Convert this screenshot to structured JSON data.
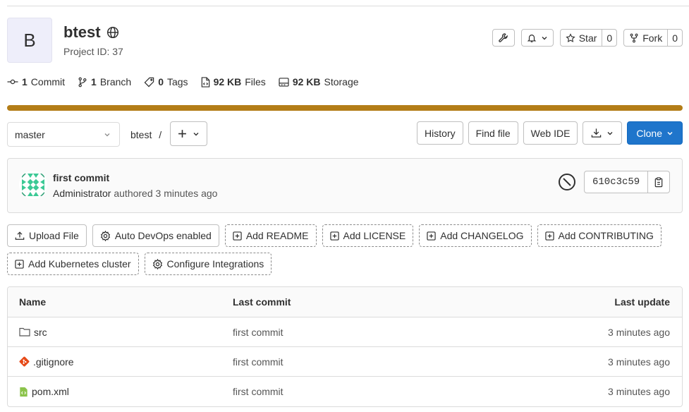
{
  "project": {
    "initial": "B",
    "name": "btest",
    "id_label": "Project ID: 37"
  },
  "actions": {
    "star_label": "Star",
    "star_count": "0",
    "fork_label": "Fork",
    "fork_count": "0"
  },
  "stats": {
    "commits_count": "1",
    "commits_label": "Commit",
    "branches_count": "1",
    "branches_label": "Branch",
    "tags_count": "0",
    "tags_label": "Tags",
    "files_size": "92 KB",
    "files_label": "Files",
    "storage_size": "92 KB",
    "storage_label": "Storage"
  },
  "storage_bar": {
    "fill_fraction": 1.0,
    "color": "#b37d17"
  },
  "toolbar": {
    "branch": "master",
    "breadcrumb_project": "btest",
    "breadcrumb_sep": "/",
    "history": "History",
    "find_file": "Find file",
    "web_ide": "Web IDE",
    "clone": "Clone"
  },
  "last_commit": {
    "title": "first commit",
    "author": "Administrator",
    "meta": "authored 3 minutes ago",
    "sha": "610c3c59"
  },
  "quick_actions": {
    "row1": [
      "Upload File",
      "Auto DevOps enabled",
      "Add README",
      "Add LICENSE",
      "Add CHANGELOG",
      "Add CONTRIBUTING"
    ],
    "row2": [
      "Add Kubernetes cluster",
      "Configure Integrations"
    ]
  },
  "file_table": {
    "headers": {
      "name": "Name",
      "last_commit": "Last commit",
      "last_update": "Last update"
    },
    "rows": [
      {
        "name": "src",
        "icon": "folder-icon",
        "commit": "first commit",
        "updated": "3 minutes ago"
      },
      {
        "name": ".gitignore",
        "icon": "git-file-icon",
        "commit": "first commit",
        "updated": "3 minutes ago"
      },
      {
        "name": "pom.xml",
        "icon": "xml-file-icon",
        "commit": "first commit",
        "updated": "3 minutes ago"
      }
    ]
  },
  "colors": {
    "primary": "#1f75cb",
    "storage": "#b37d17",
    "avatar_bg": "#eeeefa"
  }
}
